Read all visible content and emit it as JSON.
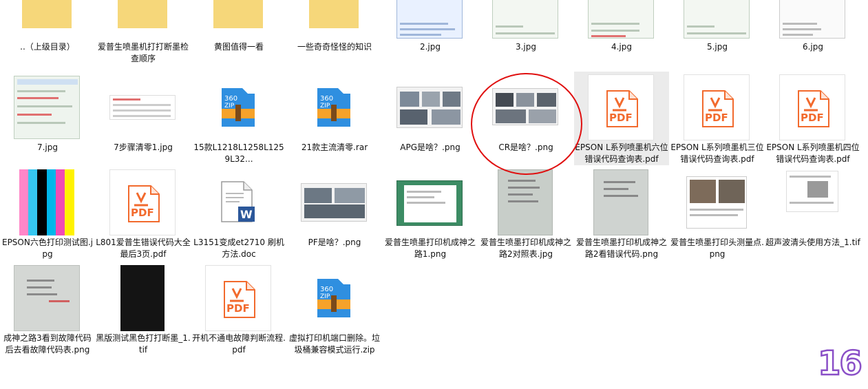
{
  "colors": {
    "pdf_orange": "#f26a2d",
    "zip_blue": "#2f8fe0",
    "zip_orange": "#f6a22a",
    "word_blue": "#2b579a",
    "annotation_red": "#e01010",
    "page_number_purple": "#8a4fc7"
  },
  "files": [
    {
      "label": "..（上级目录）",
      "icon": "folder-icon"
    },
    {
      "label": "爱普生喷墨机打打断墨检查顺序",
      "icon": "folder-icon"
    },
    {
      "label": "黄图值得一看",
      "icon": "folder-icon"
    },
    {
      "label": "一些奇奇怪怪的知识",
      "icon": "folder-icon"
    },
    {
      "label": "2.jpg",
      "icon": "image-thumbnail"
    },
    {
      "label": "3.jpg",
      "icon": "image-thumbnail"
    },
    {
      "label": "4.jpg",
      "icon": "image-thumbnail"
    },
    {
      "label": "5.jpg",
      "icon": "image-thumbnail"
    },
    {
      "label": "6.jpg",
      "icon": "image-thumbnail"
    },
    {
      "label": "7.jpg",
      "icon": "image-thumbnail"
    },
    {
      "label": "7步骤清零1.jpg",
      "icon": "image-thumbnail"
    },
    {
      "label": "15款L1218L1258L1259L32...",
      "icon": "zip-icon"
    },
    {
      "label": "21款主流清零.rar",
      "icon": "zip-icon"
    },
    {
      "label": "APG是啥？.png",
      "icon": "image-thumbnail"
    },
    {
      "label": "CR是啥？.png",
      "icon": "image-thumbnail"
    },
    {
      "label": "EPSON L系列喷墨机六位错误代码查询表.pdf",
      "icon": "pdf-icon"
    },
    {
      "label": "EPSON L系列喷墨机三位错误代码查询表.pdf",
      "icon": "pdf-icon"
    },
    {
      "label": "EPSON L系列喷墨机四位错误代码查询表.pdf",
      "icon": "pdf-icon"
    },
    {
      "label": "EPSON六色打印测试图.jpg",
      "icon": "color-bars-thumbnail"
    },
    {
      "label": "L801爱普生错误代码大全最后3页.pdf",
      "icon": "pdf-icon"
    },
    {
      "label": "L3151变成et2710 刷机方法.doc",
      "icon": "word-doc-icon"
    },
    {
      "label": "PF是啥？.png",
      "icon": "image-thumbnail"
    },
    {
      "label": "爱普生喷墨打印机成神之路1.png",
      "icon": "image-thumbnail"
    },
    {
      "label": "爱普生喷墨打印机成神之路2对照表.jpg",
      "icon": "image-thumbnail"
    },
    {
      "label": "爱普生喷墨打印机成神之路2看错误代码.png",
      "icon": "image-thumbnail"
    },
    {
      "label": "爱普生喷墨打印头测量点.png",
      "icon": "image-thumbnail"
    },
    {
      "label": "超声波清头使用方法_1.tif",
      "icon": "image-thumbnail"
    },
    {
      "label": "成神之路3看到故障代码后去看故障代码表.png",
      "icon": "image-thumbnail"
    },
    {
      "label": "黑版测试黑色打打断墨_1.tif",
      "icon": "black-image-thumbnail"
    },
    {
      "label": "开机不通电故障判断流程.pdf",
      "icon": "pdf-icon"
    },
    {
      "label": "虚拟打印机端口删除。垃圾桶兼容模式运行.zip",
      "icon": "zip-icon"
    }
  ],
  "page_number": "16"
}
